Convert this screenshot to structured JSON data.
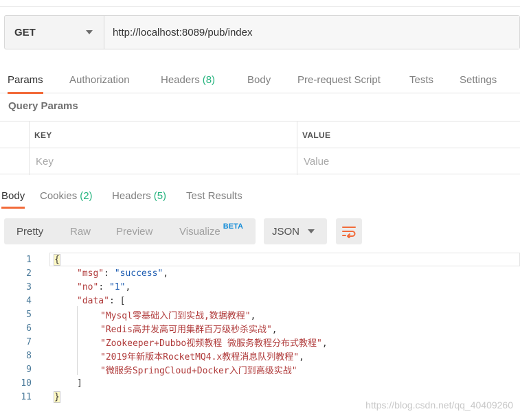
{
  "request": {
    "method": "GET",
    "url": "http://localhost:8089/pub/index"
  },
  "request_tabs": [
    {
      "label": "Params",
      "count": ""
    },
    {
      "label": "Authorization",
      "count": ""
    },
    {
      "label": "Headers",
      "count": "(8)"
    },
    {
      "label": "Body",
      "count": ""
    },
    {
      "label": "Pre-request Script",
      "count": ""
    },
    {
      "label": "Tests",
      "count": ""
    },
    {
      "label": "Settings",
      "count": ""
    }
  ],
  "query_params": {
    "title": "Query Params",
    "key_header": "KEY",
    "value_header": "VALUE",
    "key_placeholder": "Key",
    "value_placeholder": "Value"
  },
  "response_tabs": [
    {
      "label": "Body",
      "count": ""
    },
    {
      "label": "Cookies",
      "count": "(2)"
    },
    {
      "label": "Headers",
      "count": "(5)"
    },
    {
      "label": "Test Results",
      "count": ""
    }
  ],
  "view_modes": [
    "Pretty",
    "Raw",
    "Preview",
    "Visualize"
  ],
  "beta_label": "BETA",
  "format": "JSON",
  "code_lines": [
    {
      "n": "1",
      "text": "{"
    },
    {
      "n": "2",
      "key": "\"msg\"",
      "sep": ": ",
      "val": "\"success\"",
      "end": ","
    },
    {
      "n": "3",
      "key": "\"no\"",
      "sep": ": ",
      "val": "\"1\"",
      "end": ","
    },
    {
      "n": "4",
      "key": "\"data\"",
      "sep": ": ",
      "val": "[",
      "end": ""
    },
    {
      "n": "5",
      "str": "\"Mysql零基础入门到实战,数据教程\"",
      "end": ","
    },
    {
      "n": "6",
      "str": "\"Redis高并发高可用集群百万级秒杀实战\"",
      "end": ","
    },
    {
      "n": "7",
      "str": "\"Zookeeper+Dubbo视频教程 微服务教程分布式教程\"",
      "end": ","
    },
    {
      "n": "8",
      "str": "\"2019年新版本RocketMQ4.x教程消息队列教程\"",
      "end": ","
    },
    {
      "n": "9",
      "str": "\"微服务SpringCloud+Docker入门到高级实战\"",
      "end": ""
    },
    {
      "n": "10",
      "text": "]"
    },
    {
      "n": "11",
      "text": "}"
    }
  ],
  "watermark": "https://blog.csdn.net/qq_40409260",
  "colors": {
    "accent": "#f26b3a",
    "count_green": "#26b47f",
    "beta_blue": "#1a8fd8"
  }
}
